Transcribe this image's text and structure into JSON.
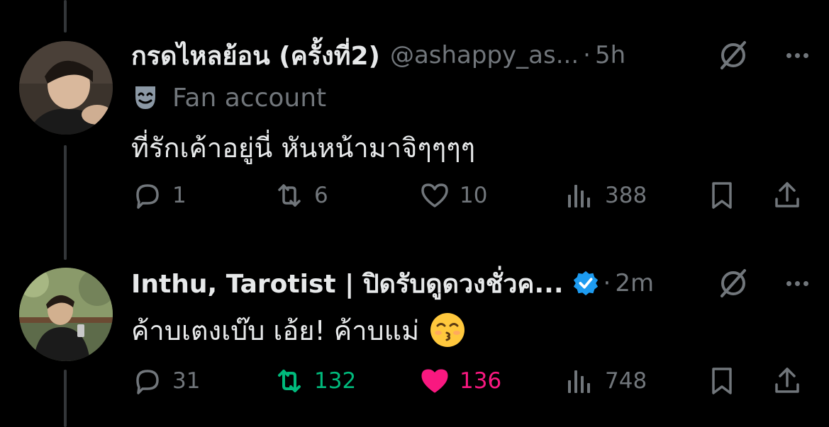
{
  "tweets": [
    {
      "name": "กรดไหลย้อน (ครั้งที่2)",
      "handle": "@ashappy_as...",
      "separator": "·",
      "time": "5h",
      "label": "Fan account",
      "text": "ที่รักเค้าอยู่นี่ หันหน้ามาจิๆๆๆๆ",
      "replies": "1",
      "retweets": "6",
      "likes": "10",
      "views": "388",
      "retweeted": false,
      "liked": false
    },
    {
      "name": "Inthu, Tarotist | ปิดรับดูดวงชั่วค...",
      "verified": true,
      "separator": "·",
      "time": "2m",
      "text": "ค้าบเตงเบ๊บ เอ้ย! ค้าบแม่",
      "emoji": "kissing-face-smiling-eyes",
      "replies": "31",
      "retweets": "132",
      "likes": "136",
      "views": "748",
      "retweeted": true,
      "liked": true
    }
  ],
  "colors": {
    "background": "#000000",
    "text": "#e7e9ea",
    "muted": "#71767b",
    "retweet_active": "#00ba7c",
    "like_active": "#f91880",
    "verified": "#1d9bf0"
  },
  "icons": [
    "reply-icon",
    "retweet-icon",
    "like-icon",
    "views-icon",
    "bookmark-icon",
    "share-icon",
    "grok-icon",
    "more-icon",
    "fan-mask-icon",
    "verified-badge-icon"
  ]
}
